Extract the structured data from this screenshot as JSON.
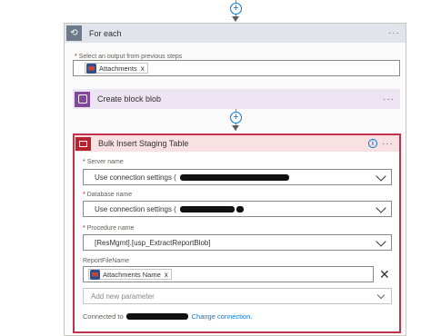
{
  "foreach": {
    "title": "For each",
    "output_label": "Select an output from previous steps",
    "output_token": "Attachments",
    "more": "···"
  },
  "create_blob": {
    "title": "Create block blob",
    "more": "···"
  },
  "bulk": {
    "title": "Bulk Insert Staging Table",
    "more": "···",
    "info": "i",
    "server_label": "Server name",
    "server_value": "Use connection settings (",
    "database_label": "Database name",
    "database_value": "Use connection settings (",
    "procedure_label": "Procedure name",
    "procedure_value": "[ResMgmt].[usp_ExtractReportBlob]",
    "reportfile_label": "ReportFileName",
    "reportfile_token": "Attachments Name",
    "add_param_placeholder": "Add new parameter",
    "connected_prefix": "Connected to",
    "change_connection": "Change connection."
  },
  "glyphs": {
    "plus": "+",
    "token_close": "x",
    "remove": "✕",
    "required": "*"
  },
  "colors": {
    "accent": "#0078d4",
    "error_border": "#c4314b",
    "blob_purple": "#804998",
    "bulk_red": "#b7222f"
  }
}
